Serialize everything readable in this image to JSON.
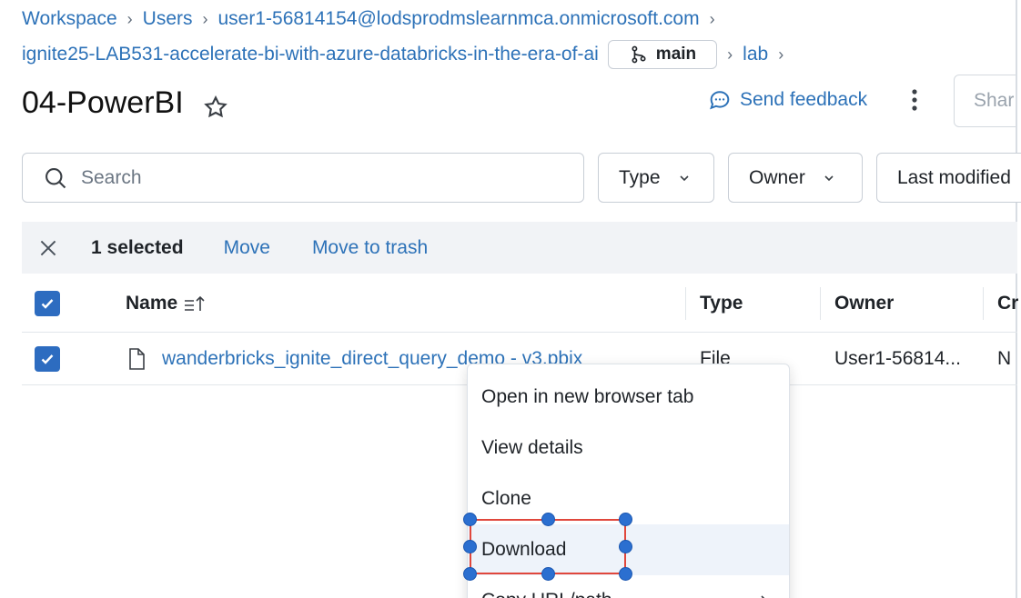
{
  "breadcrumb": {
    "line1": [
      "Workspace",
      "Users",
      "user1-56814154@lodsprodmslearnmca.onmicrosoft.com"
    ],
    "repo": "ignite25-LAB531-accelerate-bi-with-azure-databricks-in-the-era-of-ai",
    "branch": "main",
    "line2_tail": [
      "lab"
    ]
  },
  "page": {
    "title": "04-PowerBI",
    "feedback_label": "Send feedback",
    "share_label": "Shar"
  },
  "filters": {
    "search_placeholder": "Search",
    "type_label": "Type",
    "owner_label": "Owner",
    "modified_label": "Last modified"
  },
  "selection_bar": {
    "count_label": "1 selected",
    "move_label": "Move",
    "trash_label": "Move to trash"
  },
  "table": {
    "headers": {
      "name": "Name",
      "type": "Type",
      "owner": "Owner",
      "created": "Cr"
    },
    "rows": [
      {
        "name": "wanderbricks_ignite_direct_query_demo - v3.pbix",
        "type": "File",
        "owner": "User1-56814...",
        "created": "N"
      }
    ]
  },
  "context_menu": {
    "items": [
      "Open in new browser tab",
      "View details",
      "Clone",
      "Download",
      "Copy URL/path"
    ],
    "highlighted_index": 3
  },
  "colors": {
    "link": "#2d72b8",
    "checkbox": "#2d6cc0",
    "selection_outline": "#e0473c",
    "handle": "#2b6fd0"
  }
}
